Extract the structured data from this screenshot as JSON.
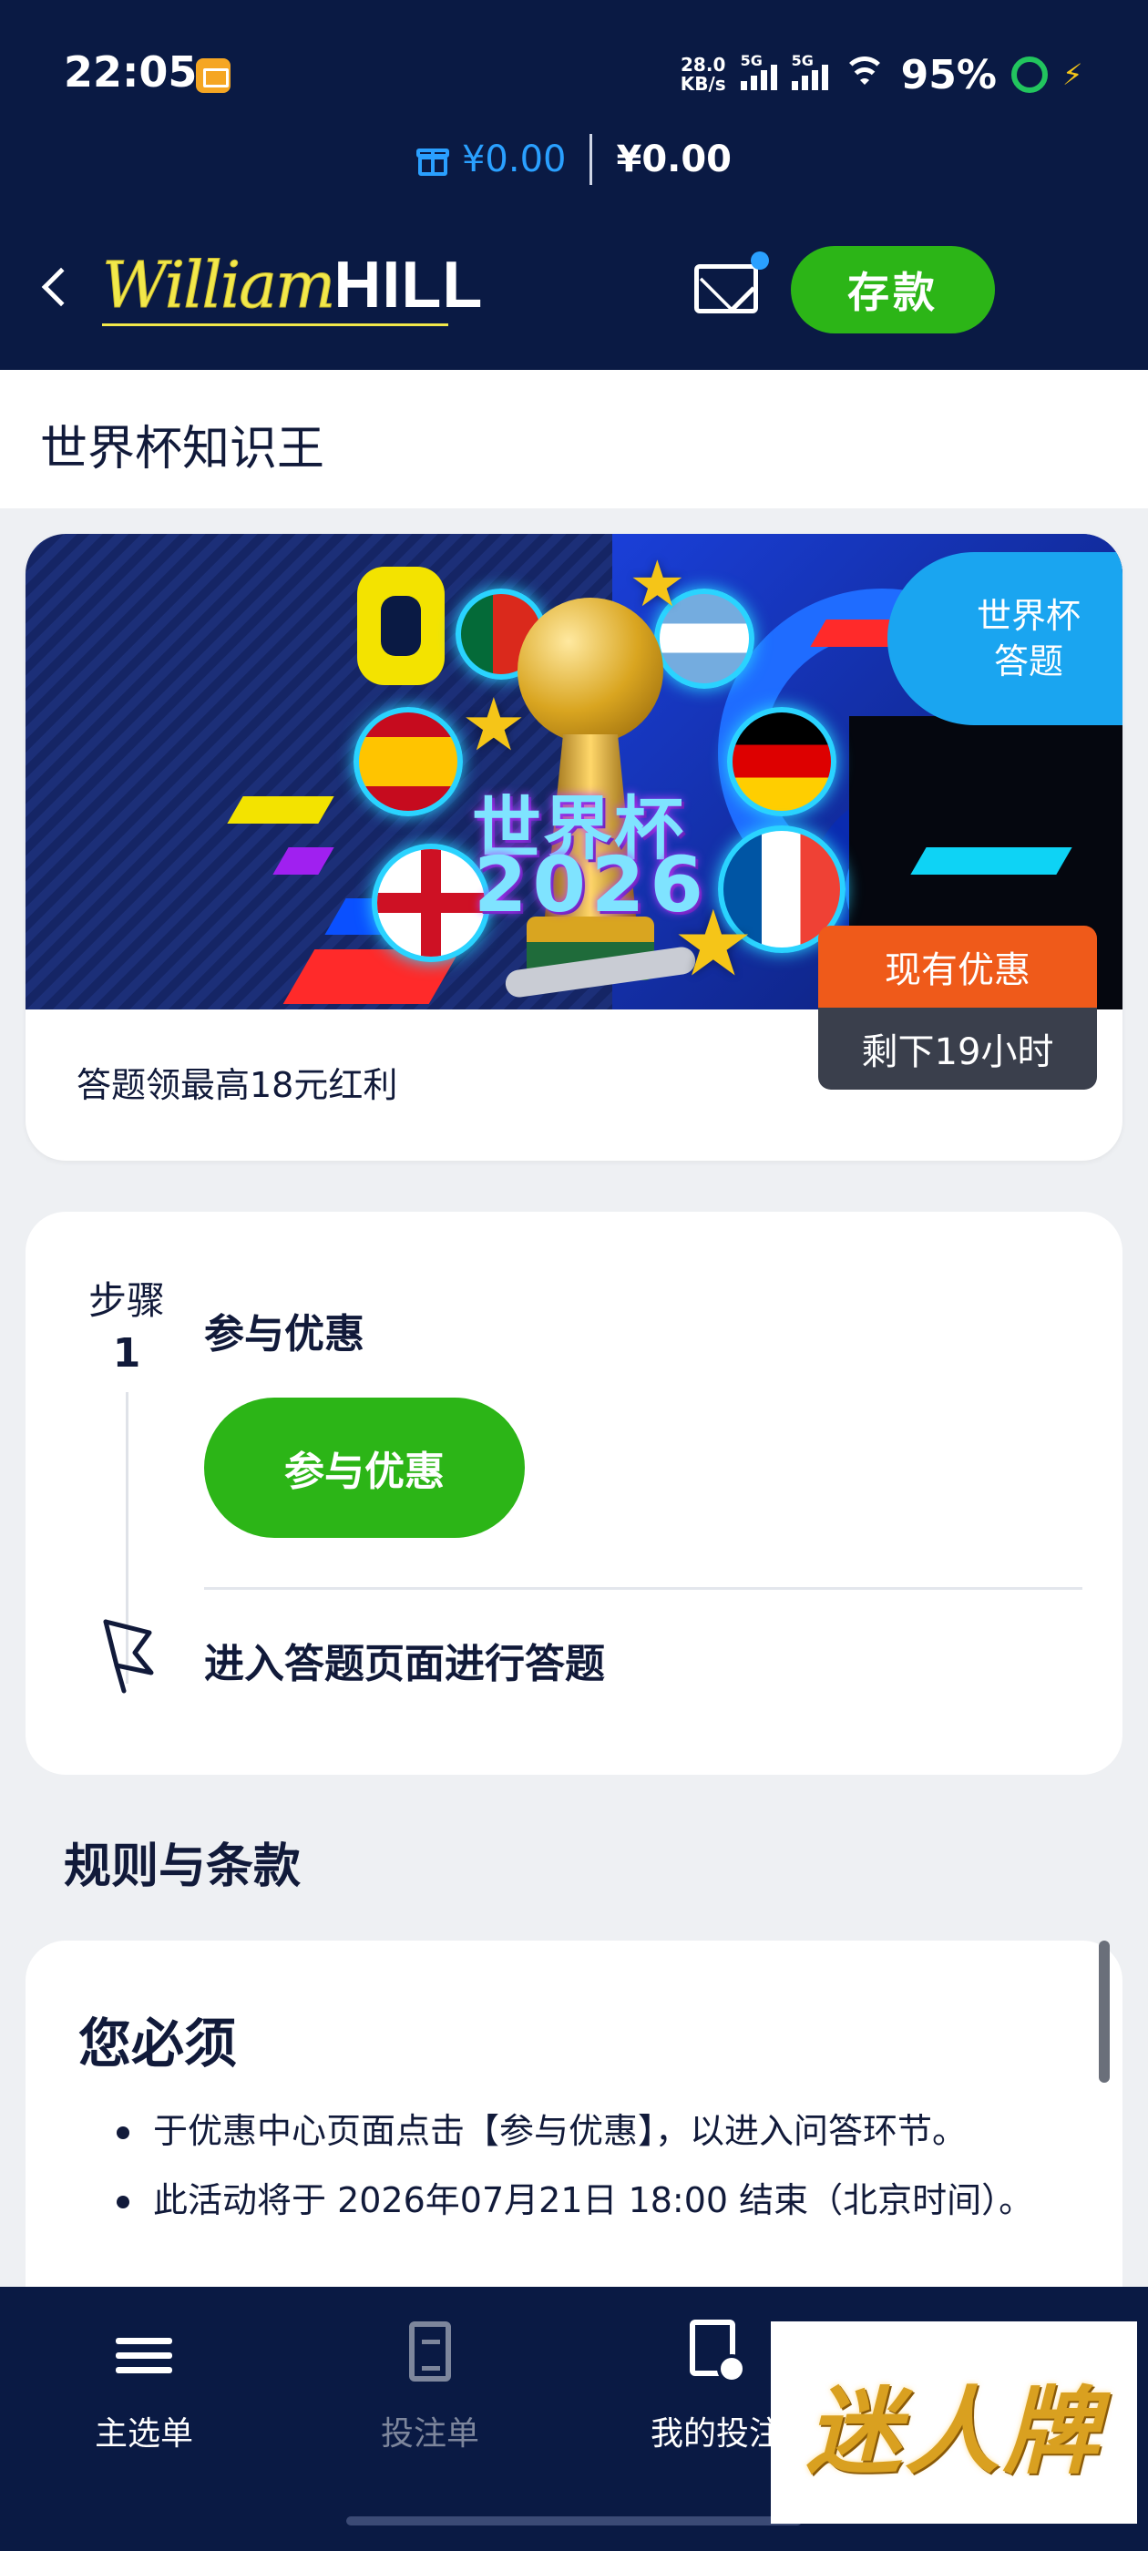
{
  "status_bar": {
    "time": "22:05",
    "net_speed_value": "28.0",
    "net_speed_unit": "KB/s",
    "sig1_label": "5G",
    "sig2_label": "5G",
    "battery": "95%"
  },
  "header": {
    "bonus_balance": "¥0.00",
    "cash_balance": "¥0.00",
    "logo_william": "William",
    "logo_hill": "HILL",
    "deposit_label": "存款"
  },
  "page": {
    "title": "世界杯知识王"
  },
  "promo": {
    "banner_title": "世界杯",
    "banner_year": "2026",
    "tag_line1": "世界杯",
    "tag_line2": "答题",
    "offer_badge": "现有优惠",
    "time_left": "剩下19小时",
    "description": "答题领最高18元红利"
  },
  "steps": {
    "step_label": "步骤",
    "step_number": "1",
    "step1_title": "参与优惠",
    "join_button": "参与优惠",
    "step2_title": "进入答题页面进行答题"
  },
  "terms": {
    "heading": "规则与条款",
    "must_title": "您必须",
    "items": [
      "于优惠中心页面点击【参与优惠】，以进入问答环节。",
      "此活动将于 2026年07月21日 18:00 结束（北京时间）。"
    ]
  },
  "bottom_nav": {
    "menu": "主选单",
    "betslip": "投注单",
    "mybets": "我的投注"
  },
  "watermark": {
    "text": "迷人牌"
  }
}
